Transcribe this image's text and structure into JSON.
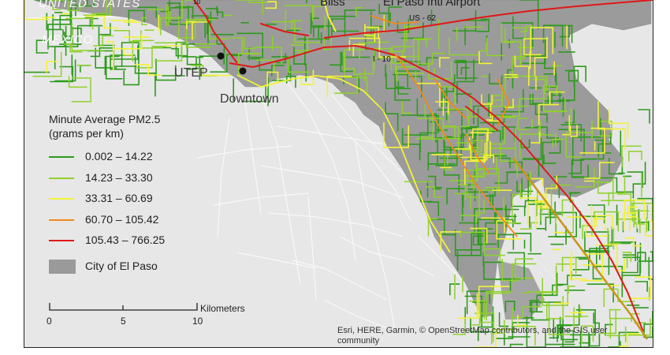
{
  "map": {
    "labels": {
      "united_states": "UNITED STATES",
      "mexico": "MEXICO",
      "bliss": "Bliss",
      "airport": "El Paso Intl Airport",
      "us62": "US - 62",
      "i10": "I - 10",
      "utep": "UTEP",
      "downtown": "Downtown",
      "border": "MEXICO MEXICO",
      "hwy_mark": "10"
    }
  },
  "legend": {
    "title_line1": "Minute Average PM2.5",
    "title_line2": "(grams per km)",
    "classes": [
      {
        "label": "0.002 – 14.22",
        "color": "#2e9a1e"
      },
      {
        "label": "14.23 – 33.30",
        "color": "#8fd12b"
      },
      {
        "label": "33.31 – 60.69",
        "color": "#f2f23a"
      },
      {
        "label": "60.70 – 105.42",
        "color": "#f08a1c"
      },
      {
        "label": "105.43 – 766.25",
        "color": "#e01818"
      }
    ],
    "area_label": "City of El Paso",
    "area_color": "#9a9a9a"
  },
  "scale_bar": {
    "units": "Kilometers",
    "ticks": [
      "0",
      "5",
      "10"
    ]
  },
  "attribution": "Esri, HERE, Garmin, © OpenStreetMap contributors, and the GIS user community"
}
